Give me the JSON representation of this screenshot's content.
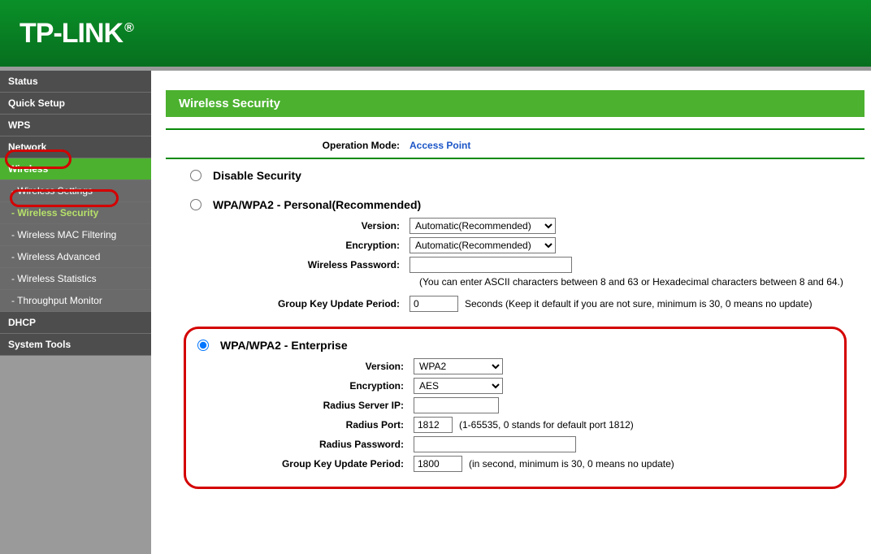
{
  "brand": "TP-LINK",
  "sidebar": {
    "items": [
      {
        "label": "Status"
      },
      {
        "label": "Quick Setup"
      },
      {
        "label": "WPS"
      },
      {
        "label": "Network"
      },
      {
        "label": "Wireless"
      },
      {
        "label": "DHCP"
      },
      {
        "label": "System Tools"
      }
    ],
    "wireless_sub": [
      {
        "label": "- Wireless Settings"
      },
      {
        "label": "- Wireless Security"
      },
      {
        "label": "- Wireless MAC Filtering"
      },
      {
        "label": "- Wireless Advanced"
      },
      {
        "label": "- Wireless Statistics"
      },
      {
        "label": "- Throughput Monitor"
      }
    ]
  },
  "page": {
    "title": "Wireless Security",
    "op_mode_label": "Operation Mode:",
    "op_mode_value": "Access Point",
    "disable_label": "Disable Security",
    "wpa_personal": {
      "title": "WPA/WPA2 - Personal(Recommended)",
      "version_label": "Version:",
      "version_value": "Automatic(Recommended)",
      "encryption_label": "Encryption:",
      "encryption_value": "Automatic(Recommended)",
      "password_label": "Wireless Password:",
      "password_value": "",
      "password_hint": "(You can enter ASCII characters between 8 and 63 or Hexadecimal characters between 8 and 64.)",
      "gkup_label": "Group Key Update Period:",
      "gkup_value": "0",
      "gkup_hint": "Seconds (Keep it default if you are not sure, minimum is 30, 0 means no update)"
    },
    "wpa_enterprise": {
      "title": "WPA/WPA2 - Enterprise",
      "version_label": "Version:",
      "version_value": "WPA2",
      "encryption_label": "Encryption:",
      "encryption_value": "AES",
      "radius_ip_label": "Radius Server IP:",
      "radius_ip_value": "",
      "radius_port_label": "Radius Port:",
      "radius_port_value": "1812",
      "radius_port_hint": "(1-65535, 0 stands for default port 1812)",
      "radius_pwd_label": "Radius Password:",
      "radius_pwd_value": "",
      "gkup_label": "Group Key Update Period:",
      "gkup_value": "1800",
      "gkup_hint": "(in second, minimum is 30, 0 means no update)"
    }
  }
}
